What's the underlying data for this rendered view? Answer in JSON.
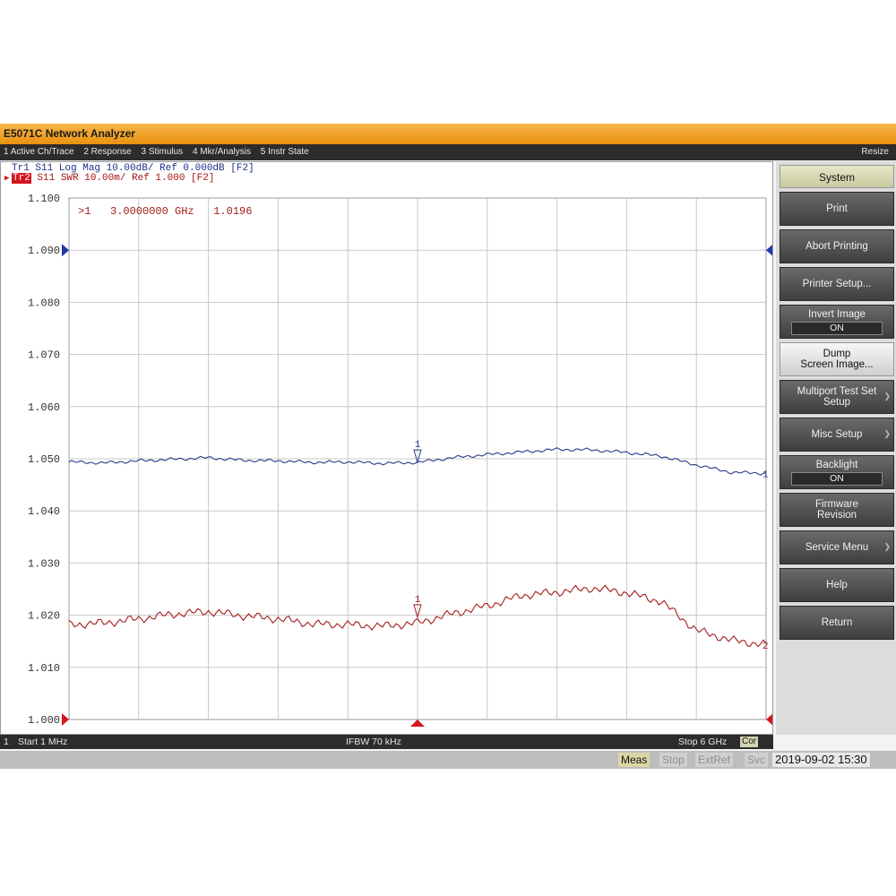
{
  "window": {
    "title": "E5071C Network Analyzer"
  },
  "menu": {
    "items": [
      "1 Active Ch/Trace",
      "2 Response",
      "3 Stimulus",
      "4 Mkr/Analysis",
      "5 Instr State"
    ],
    "resize": "Resize"
  },
  "traces": {
    "tr1": "Tr1  S11  Log Mag 10.00dB/ Ref 0.000dB [F2]",
    "tr2_badge": "Tr2",
    "tr2": " S11  SWR 10.00m/ Ref 1.000  [F2]"
  },
  "marker": {
    "readout": ">1   3.0000000 GHz   1.0196"
  },
  "softkeys": {
    "system": "System",
    "print": "Print",
    "abort_printing": "Abort Printing",
    "printer_setup": "Printer Setup...",
    "invert_image": "Invert Image",
    "invert_image_value": "ON",
    "dump_line1": "Dump",
    "dump_line2": "Screen Image...",
    "multiport_line1": "Multiport Test Set",
    "multiport_line2": "Setup",
    "misc_setup": "Misc Setup",
    "backlight": "Backlight",
    "backlight_value": "ON",
    "firmware_line1": "Firmware",
    "firmware_line2": "Revision",
    "service_menu": "Service Menu",
    "help": "Help",
    "return": "Return"
  },
  "status": {
    "channel": "1",
    "start": "Start 1 MHz",
    "ifbw": "IFBW 70 kHz",
    "stop": "Stop 6 GHz",
    "cor": "Cor"
  },
  "bottom": {
    "meas": "Meas",
    "stop": "Stop",
    "extref": "ExtRef",
    "svc": "Svc",
    "datetime": "2019-09-02 15:30"
  },
  "colors": {
    "trace1": "#2a3a8c",
    "trace2": "#a51d1d",
    "marker_triangle": "#d4161f",
    "reference_triangle": "#1f36a8",
    "grid": "#c8c8c8"
  },
  "chart_data": {
    "type": "line",
    "x_unit": "GHz",
    "x_range": [
      0.001,
      6
    ],
    "ylim": [
      1.0,
      1.1
    ],
    "y_ticks": [
      "1.100",
      "1.090",
      "1.080",
      "1.070",
      "1.060",
      "1.050",
      "1.040",
      "1.030",
      "1.020",
      "1.010",
      "1.000"
    ],
    "grid": true,
    "series": [
      {
        "name": "1",
        "x": [
          0.001,
          0.3,
          0.6,
          0.9,
          1.2,
          1.5,
          1.8,
          2.1,
          2.4,
          2.7,
          3.0,
          3.3,
          3.6,
          3.9,
          4.2,
          4.5,
          4.8,
          5.1,
          5.4,
          5.7,
          6.0
        ],
        "values": [
          1.0494,
          1.0492,
          1.0496,
          1.0499,
          1.0502,
          1.0497,
          1.0496,
          1.0493,
          1.0494,
          1.0491,
          1.0493,
          1.0502,
          1.0508,
          1.0513,
          1.0518,
          1.0517,
          1.0512,
          1.0505,
          1.0488,
          1.0474,
          1.0472
        ]
      },
      {
        "name": "2",
        "x": [
          0.001,
          0.3,
          0.6,
          0.9,
          1.2,
          1.5,
          1.8,
          2.1,
          2.4,
          2.7,
          3.0,
          3.3,
          3.6,
          3.9,
          4.2,
          4.5,
          4.8,
          5.1,
          5.4,
          5.7,
          6.0
        ],
        "values": [
          1.0182,
          1.0185,
          1.0193,
          1.0202,
          1.0207,
          1.0199,
          1.0193,
          1.0183,
          1.0182,
          1.0179,
          1.0185,
          1.0203,
          1.0218,
          1.0238,
          1.0244,
          1.0252,
          1.0243,
          1.0226,
          1.0171,
          1.0152,
          1.0143
        ]
      }
    ],
    "markers": [
      {
        "label": "1",
        "x": 3.0,
        "trace1_value": 1.0493,
        "trace2_value": 1.0196
      }
    ],
    "end_labels": [
      "1",
      "2"
    ]
  }
}
